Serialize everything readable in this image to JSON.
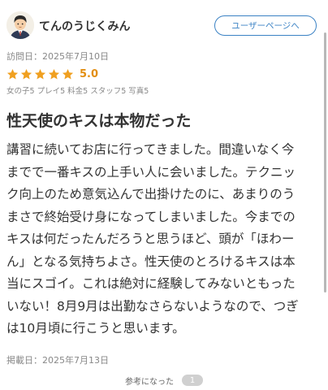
{
  "reviewer": {
    "name": "てんのうじくみん",
    "user_page_button": "ユーザーページへ"
  },
  "visit_date": "訪問日：2025年7月10日",
  "rating": {
    "score": "5.0",
    "stars": 5,
    "star_color": "#f0a020",
    "sub_scores": "女の子5 プレイ5 料金5 スタッフ5 写真5"
  },
  "review": {
    "title": "性天使のキスは本物だった",
    "body": "講習に続いてお店に行ってきました。間違いなく今\nまでで一番キスの上手い人に会いました。テクニッ\nク向上のため意気込んで出掛けたのに、あまりのう\nまさで終始受け身になってしまいました。今までの\nキスは何だったんだろうと思うほど、頭が「ほわー\nん」となる気持ちよさ。性天使のとろけるキスは本\n当にスゴイ。これは絶対に経験してみないともった\nいない！8月9月は出勤なさらないようなので、つぎ\nは10月頃に行こうと思います。",
    "posted_date": "掲載日：2025年7月13日"
  },
  "helpful": {
    "label": "参考になった",
    "count": "1"
  },
  "colors": {
    "accent": "#3b82c4",
    "score": "#e28e12"
  }
}
